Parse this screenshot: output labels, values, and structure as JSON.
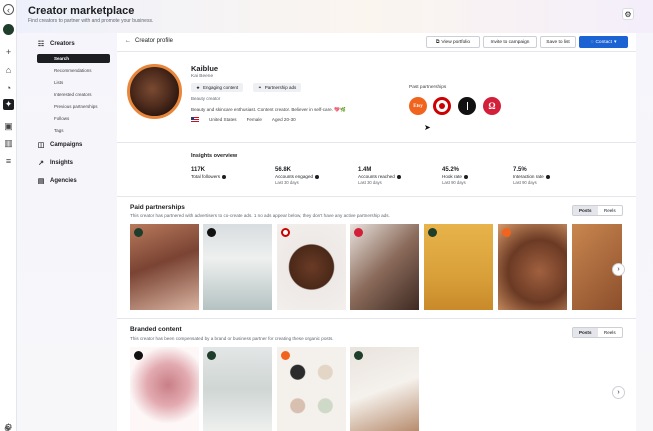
{
  "app": {
    "title": "Creator marketplace",
    "subtitle": "Find creators to partner with and promote your business."
  },
  "nav": {
    "sections": [
      {
        "label": "Creators",
        "icon": "person-search-icon"
      },
      {
        "label": "Campaigns",
        "icon": "megaphone-icon"
      },
      {
        "label": "Insights",
        "icon": "chart-line-icon"
      },
      {
        "label": "Agencies",
        "icon": "building-icon"
      }
    ],
    "subitems": [
      "Search",
      "Recommendations",
      "Lists",
      "Interested creators",
      "Previous partnerships",
      "Follows",
      "Tags"
    ],
    "selected": "Search"
  },
  "toolbar": {
    "back_label": "Creator profile",
    "view_portfolio": "View portfolio",
    "invite": "Invite to campaign",
    "save": "Save to list",
    "contact": "Contact"
  },
  "profile": {
    "name": "Kaiblue",
    "handle": "Kai Beene",
    "badges": [
      "Engaging content",
      "Partnership ads"
    ],
    "role": "Beauty creator",
    "bio": "Beauty and skincare enthusiast. Content creator. Believer in self-care. 💖🌿",
    "country": "United States",
    "gender": "Female",
    "age": "Aged 20-30"
  },
  "past_partnerships": {
    "label": "Past partnerships",
    "brands": [
      {
        "name": "Etsy",
        "color": "#f1641e"
      },
      {
        "name": "Target",
        "color": "#cc0000"
      },
      {
        "name": "",
        "color": "#111111"
      },
      {
        "name": "Lululemon",
        "color": "#d31f3a"
      }
    ]
  },
  "insights": {
    "title": "Insights overview",
    "stats": [
      {
        "value": "117K",
        "label": "Total followers",
        "period": ""
      },
      {
        "value": "56.8K",
        "label": "Accounts engaged",
        "period": "Last 30 days"
      },
      {
        "value": "1.4M",
        "label": "Accounts reached",
        "period": "Last 30 days"
      },
      {
        "value": "45.2%",
        "label": "Hook rate",
        "period": "Last 90 days"
      },
      {
        "value": "7.5%",
        "label": "Interaction rate",
        "period": "Last 90 days"
      }
    ]
  },
  "paid": {
    "title": "Paid partnerships",
    "desc": "This creator has partnered with advertisers to co-create ads. 1 no ads appear below, they don't have any active partnership ads.",
    "tabs": [
      "Posts",
      "Reels"
    ],
    "active_tab": "Posts"
  },
  "branded": {
    "title": "Branded content",
    "desc": "This creator has been compensated by a brand or business partner for creating these organic posts.",
    "tabs": [
      "Posts",
      "Reels"
    ],
    "active_tab": "Posts"
  },
  "colors": {
    "accent": "#1b62d3",
    "selected_nav": "#1c1e21",
    "avatar_ring": "#e8863b"
  }
}
